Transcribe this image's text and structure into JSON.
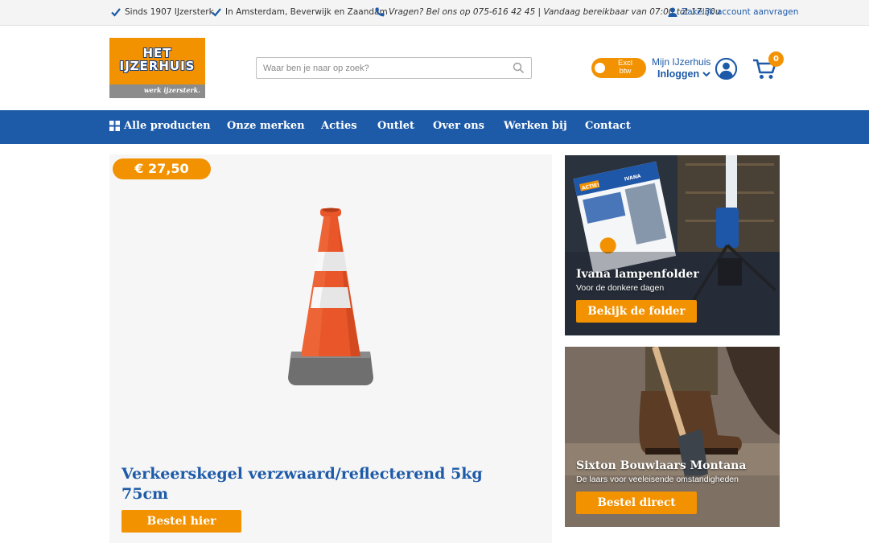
{
  "topbar": {
    "usp1": "Sinds 1907 IJzersterk",
    "usp2": "In Amsterdam, Beverwijk en Zaandam",
    "usp3": "Vragen? Bel ons op 075-616 42 45 | Vandaag bereikbaar van 07:00 tot 17:30u",
    "usp4": "Zakelijk account aanvragen"
  },
  "logo": {
    "line1": "HET",
    "line2": "IJZERHUIS",
    "tagline": "werk ijzersterk."
  },
  "search": {
    "placeholder": "Waar ben je naar op zoek?"
  },
  "vat_toggle": {
    "line1": "Excl",
    "line2": "btw"
  },
  "account": {
    "title": "Mijn IJzerhuis",
    "login": "Inloggen"
  },
  "cart": {
    "count": "0"
  },
  "nav": {
    "all_products": "Alle producten",
    "brands": "Onze merken",
    "promotions": "Acties",
    "outlet": "Outlet",
    "about": "Over ons",
    "jobs": "Werken bij",
    "contact": "Contact"
  },
  "product": {
    "price": "€ 27,50",
    "title": "Verkeerskegel verzwaard/reflecterend 5kg 75cm",
    "button": "Bestel hier"
  },
  "promo1": {
    "title": "Ivana lampenfolder",
    "subtitle": "Voor de donkere dagen",
    "button": "Bekijk de folder",
    "badge": "ACTIE!",
    "brand": "IVANA"
  },
  "promo2": {
    "title": "Sixton Bouwlaars Montana",
    "subtitle": "De laars voor veeleisende omstandigheden",
    "button": "Bestel direct"
  },
  "colors": {
    "brand_blue": "#1d5aa8",
    "brand_orange": "#f39200"
  }
}
